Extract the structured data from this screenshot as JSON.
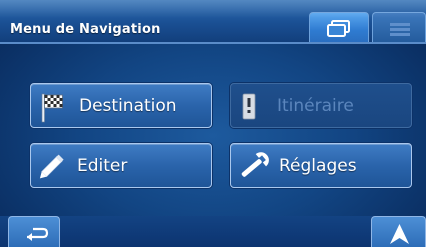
{
  "header": {
    "title": "Menu de Navigation",
    "tabs": [
      {
        "icon": "windows-icon",
        "active": true
      },
      {
        "icon": "list-icon",
        "active": false
      }
    ]
  },
  "menu": {
    "destination": {
      "label": "Destination",
      "icon": "flag-icon",
      "enabled": true
    },
    "itineraire": {
      "label": "Itinéraire",
      "icon": "route-icon",
      "enabled": false
    },
    "editer": {
      "label": "Editer",
      "icon": "pencil-icon",
      "enabled": true
    },
    "reglages": {
      "label": "Réglages",
      "icon": "wrench-icon",
      "enabled": true
    }
  },
  "footer": {
    "back_icon": "back-arrow-icon",
    "navigate_icon": "navigation-arrow-icon"
  },
  "colors": {
    "background": "#124583",
    "button": "#2a64ab",
    "button_border": "#aac8ee",
    "disabled_text": "#5b86bd",
    "tab_active": "#2f7bd1"
  }
}
